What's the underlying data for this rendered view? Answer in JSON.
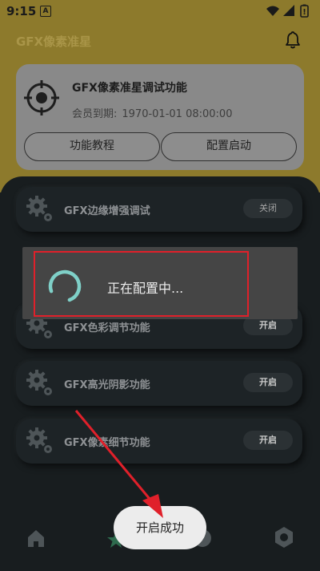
{
  "status_bar": {
    "time": "9:15",
    "notif_letter": "A"
  },
  "header": {
    "title": "GFX像素准星"
  },
  "card": {
    "title": "GFX像素准星调试功能",
    "member_label": "会员到期:",
    "member_value": "1970-01-01 08:00:00",
    "tutorial_button": "功能教程",
    "config_button": "配置启动"
  },
  "features": [
    {
      "label": "GFX边缘增强调试",
      "toggle": "关闭"
    },
    {
      "label": "GFX色彩调节功能",
      "toggle": "开启"
    },
    {
      "label": "GFX高光阴影功能",
      "toggle": "开启"
    },
    {
      "label": "GFX像素细节功能",
      "toggle": "开启"
    }
  ],
  "dialog": {
    "message": "正在配置中..."
  },
  "toast": {
    "message": "开启成功"
  },
  "colors": {
    "accent_yellow": "#8d7a2c",
    "highlight_red": "#e0202a",
    "spinner": "#7fd0c8"
  },
  "icons": {
    "bell": "bell-icon",
    "crosshair": "crosshair-icon",
    "gear": "gear-icon",
    "home": "home-icon",
    "star": "star-icon",
    "settings": "hexagon-settings-icon"
  }
}
